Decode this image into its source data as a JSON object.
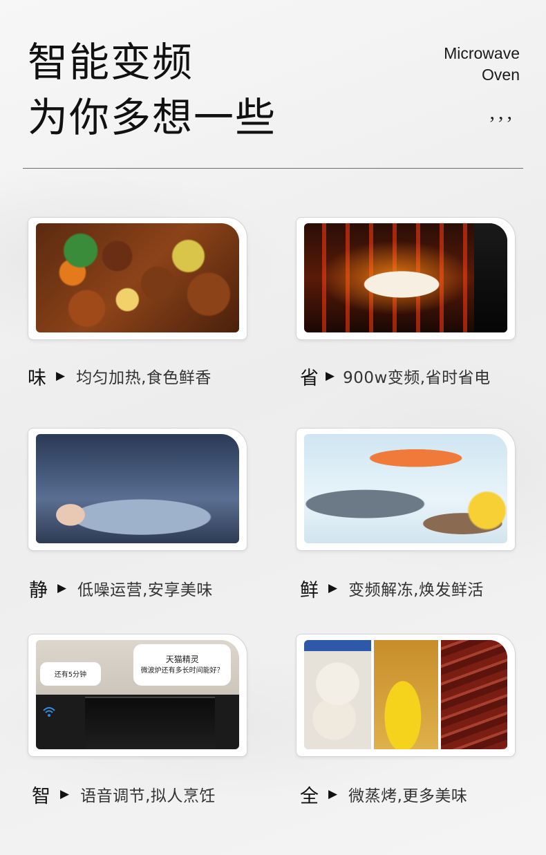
{
  "header": {
    "title_line1": "智能变频",
    "title_line2": "为你多想一些",
    "brand_line1": "Microwave",
    "brand_line2": "Oven",
    "ticks": ",,,"
  },
  "features": [
    {
      "char": "味",
      "arrow": "▶",
      "desc": "均匀加热,食色鲜香"
    },
    {
      "char": "省",
      "arrow": "▶",
      "desc": "900w变频,省时省电"
    },
    {
      "char": "静",
      "arrow": "▶",
      "desc": "低噪运营,安享美味"
    },
    {
      "char": "鲜",
      "arrow": "▶",
      "desc": "变频解冻,焕发鲜活"
    },
    {
      "char": "智",
      "arrow": "▶",
      "desc": "语音调节,拟人烹饪"
    },
    {
      "char": "全",
      "arrow": "▶",
      "desc": "微蒸烤,更多美味"
    }
  ],
  "voice_photo": {
    "bubble_small": "还有5分钟",
    "bubble_title": "天猫精灵",
    "bubble_question": "微波炉还有多长时间能好？"
  }
}
